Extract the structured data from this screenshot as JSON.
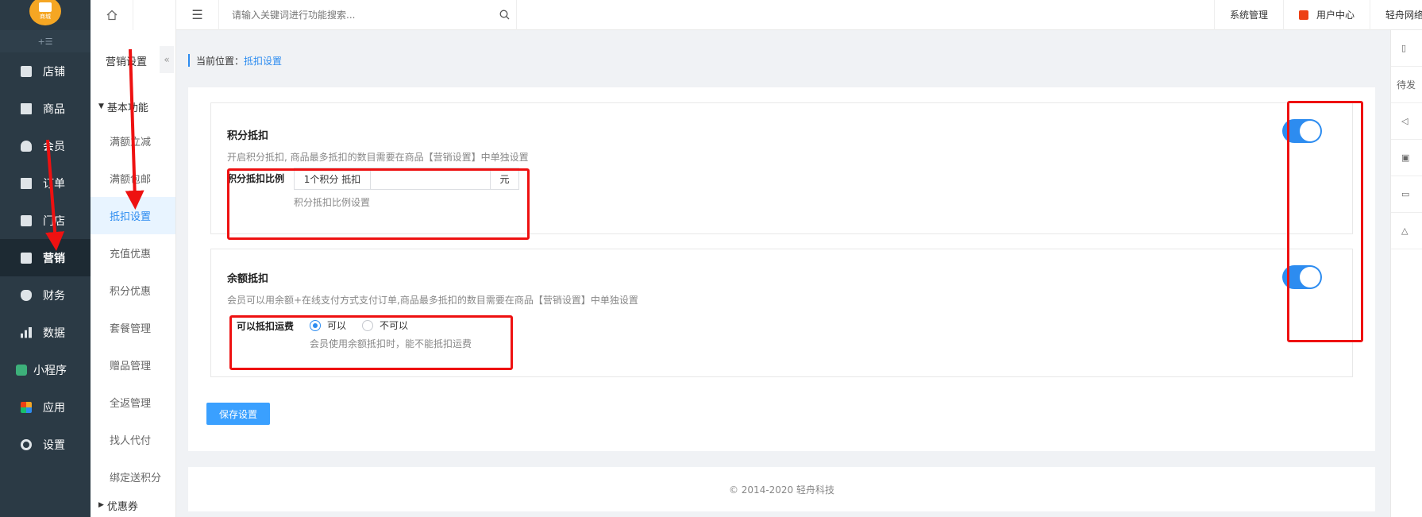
{
  "logo": {
    "text": "商城"
  },
  "nav": [
    {
      "label": "店铺",
      "icon": "store-icon"
    },
    {
      "label": "商品",
      "icon": "goods-icon"
    },
    {
      "label": "会员",
      "icon": "user-icon"
    },
    {
      "label": "订单",
      "icon": "order-icon"
    },
    {
      "label": "门店",
      "icon": "shop-icon"
    },
    {
      "label": "营销",
      "icon": "gift-icon",
      "active": true
    },
    {
      "label": "财务",
      "icon": "money-bag-icon"
    },
    {
      "label": "数据",
      "icon": "bar-chart-icon"
    },
    {
      "label": "小程序",
      "icon": "mini-program-icon"
    },
    {
      "label": "应用",
      "icon": "apps-icon"
    },
    {
      "label": "设置",
      "icon": "gear-icon"
    }
  ],
  "submenu": {
    "title": "营销设置",
    "group": "基本功能",
    "items": [
      {
        "label": "满额立减"
      },
      {
        "label": "满额包邮"
      },
      {
        "label": "抵扣设置",
        "active": true
      },
      {
        "label": "充值优惠"
      },
      {
        "label": "积分优惠"
      },
      {
        "label": "套餐管理"
      },
      {
        "label": "赠品管理"
      },
      {
        "label": "全返管理"
      },
      {
        "label": "找人代付"
      },
      {
        "label": "绑定送积分"
      }
    ],
    "next_group": "优惠券"
  },
  "header": {
    "search_placeholder": "请输入关键词进行功能搜索...",
    "system_label": "系统管理",
    "user_center_label": "用户中心",
    "company_label": "轻舟网络"
  },
  "rail": {
    "pending_label": "待发"
  },
  "breadcrumb": {
    "prefix": "当前位置：",
    "current": "抵扣设置"
  },
  "points_section": {
    "title": "积分抵扣",
    "description": "开启积分抵扣, 商品最多抵扣的数目需要在商品【营销设置】中单独设置",
    "enabled": true,
    "ratio_label": "积分抵扣比例",
    "ratio_prefix": "1个积分 抵扣",
    "ratio_value": "",
    "ratio_suffix": "元",
    "ratio_hint": "积分抵扣比例设置"
  },
  "balance_section": {
    "title": "余额抵扣",
    "description": "会员可以用余额+在线支付方式支付订单,商品最多抵扣的数目需要在商品【营销设置】中单独设置",
    "enabled": true,
    "freight_label": "可以抵扣运费",
    "option_yes": "可以",
    "option_no": "不可以",
    "selected": "可以",
    "freight_hint": "会员使用余额抵扣时，能不能抵扣运费"
  },
  "save_label": "保存设置",
  "footer": {
    "copyright": "© 2014-2020 轻舟科技"
  },
  "colors": {
    "accent": "#2d8cf0",
    "sidebar": "#2b3a45",
    "annotation": "#ee1111"
  }
}
